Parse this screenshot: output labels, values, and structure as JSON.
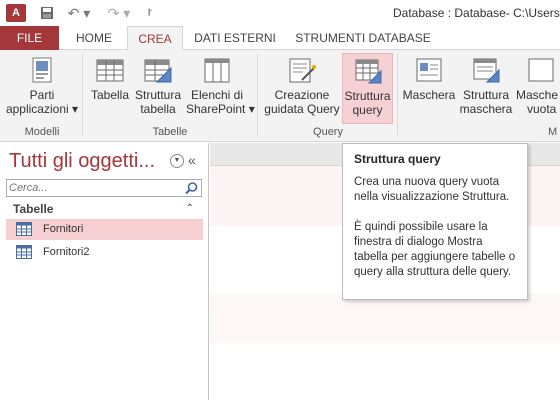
{
  "titlebar": {
    "app_logo": "A",
    "title": "Database : Database- C:\\Users\\"
  },
  "tabs": [
    {
      "label": "FILE"
    },
    {
      "label": "HOME"
    },
    {
      "label": "CREA"
    },
    {
      "label": "DATI ESTERNI"
    },
    {
      "label": "STRUMENTI DATABASE"
    }
  ],
  "ribbon": {
    "parti_applicazioni": {
      "line1": "Parti",
      "line2": "applicazioni ▾"
    },
    "tabella": {
      "line1": "Tabella",
      "line2": ""
    },
    "struttura_tabella": {
      "line1": "Struttura",
      "line2": "tabella"
    },
    "elenchi_sharepoint": {
      "line1": "Elenchi di",
      "line2": "SharePoint ▾"
    },
    "creazione_guidata_query": {
      "line1": "Creazione",
      "line2": "guidata Query"
    },
    "struttura_query": {
      "line1": "Struttura",
      "line2": "query"
    },
    "maschera": {
      "line1": "Maschera",
      "line2": ""
    },
    "struttura_maschera": {
      "line1": "Struttura",
      "line2": "maschera"
    },
    "maschera_vuota": {
      "line1": "Masche",
      "line2": "vuota"
    },
    "groups": {
      "modelli": "Modelli",
      "tabelle": "Tabelle",
      "query": "Query",
      "maschere": "M"
    }
  },
  "navpane": {
    "title": "Tutti gli oggetti...",
    "search_placeholder": "Cerca...",
    "group_label": "Tabelle",
    "items": [
      {
        "label": "Fornitori",
        "selected": true
      },
      {
        "label": "Fornitori2",
        "selected": false
      }
    ]
  },
  "tooltip": {
    "title": "Struttura query",
    "line1": "Crea una nuova query vuota nella visualizzazione Struttura.",
    "line2": "È quindi possibile usare la finestra di dialogo Mostra tabella per aggiungere tabelle o query alla struttura delle query."
  },
  "colors": {
    "accent": "#a4373a",
    "selection": "#f6cfd2",
    "ribbon_bg": "#f3f3f3"
  }
}
